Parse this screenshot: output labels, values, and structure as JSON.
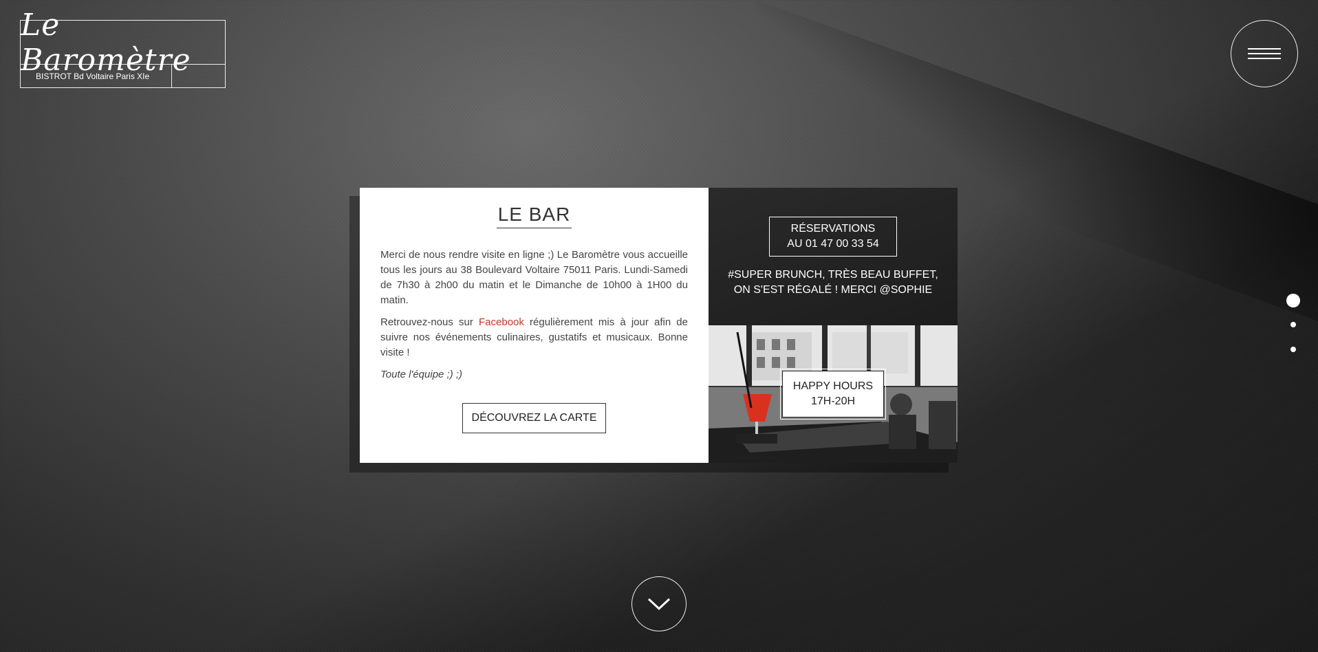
{
  "header": {
    "logo_title": "Le Baromètre",
    "logo_subtitle": "BISTROT Bd Voltaire Paris XIe",
    "menu_icon": "hamburger-menu-icon"
  },
  "card": {
    "title": "LE BAR",
    "intro": "Merci de nous rendre visite en ligne ;) Le Baromètre vous accueille tous les jours au 38 Boulevard Voltaire 75011 Paris. Lundi-Samedi de 7h30 à 2h00 du matin et le Dimanche de 10h00 à 1H00 du matin.",
    "p2_before": "Retrouvez-nous sur ",
    "p2_link": "Facebook",
    "p2_after": " régulièrement mis à jour afin de suivre nos événements culinaires, gustatifs et musicaux. Bonne visite !",
    "signature": "Toute l'équipe ;) ;)",
    "carte_button": "DÉCOUVREZ LA CARTE"
  },
  "reservations": {
    "line1": "RÉSERVATIONS",
    "line2": "AU 01 47 00 33 54"
  },
  "promo": {
    "line1": "#SUPER BRUNCH, TRÈS BEAU BUFFET,",
    "line2": "ON S'EST RÉGALÉ ! MERCI @SOPHIE"
  },
  "happy_hours": {
    "line1": "HAPPY HOURS",
    "line2": "17H-20H"
  },
  "nav_dots": {
    "count": 3,
    "active_index": 0
  },
  "scroll_icon": "chevron-down-icon",
  "colors": {
    "link": "#c0392b",
    "card_bg": "#ffffff",
    "dark_panel": "#1f1f1f"
  }
}
